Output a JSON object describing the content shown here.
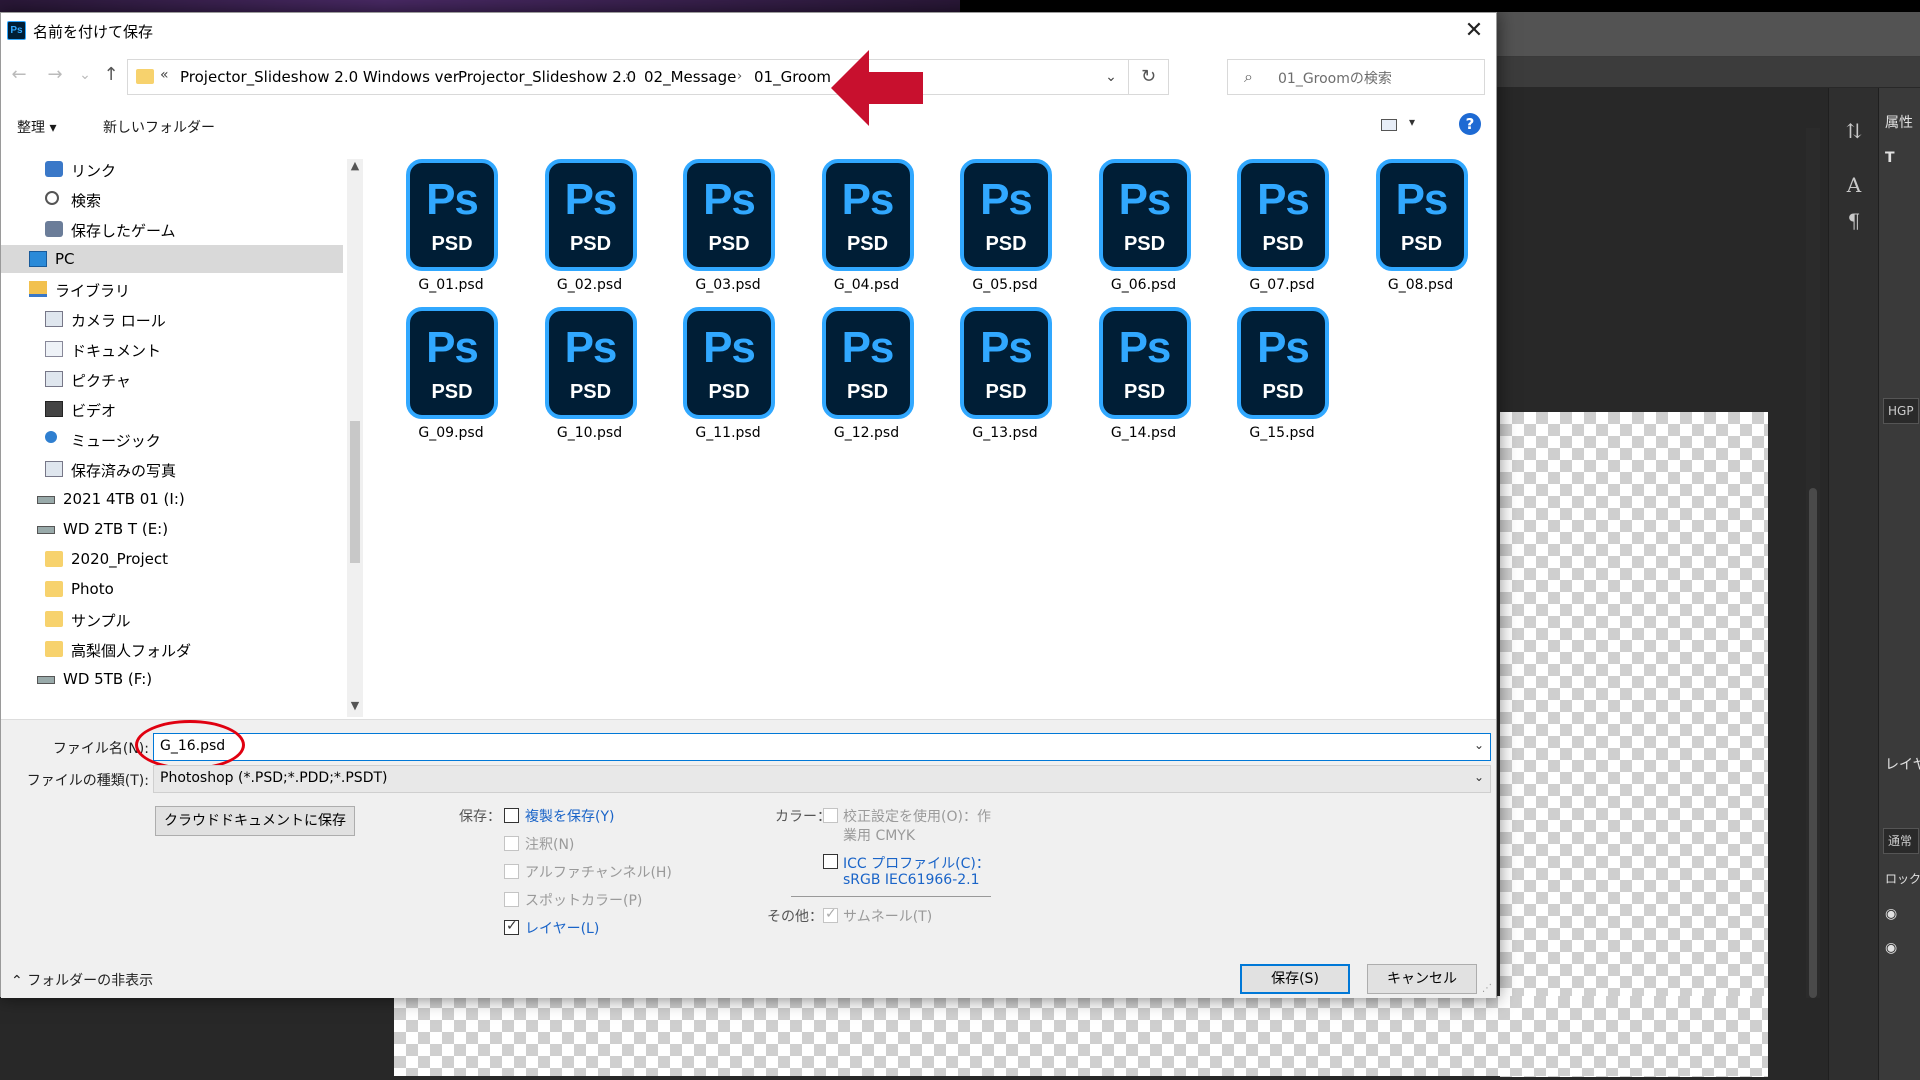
{
  "dialog": {
    "title": "名前を付けて保存",
    "app_icon_text": "Ps",
    "close_glyph": "✕"
  },
  "nav": {
    "back": "←",
    "forward": "→",
    "recent": "⌄",
    "up": "↑"
  },
  "address": {
    "overflow": "«",
    "crumbs": [
      "Projector_Slideshow 2.0 Windows ver",
      "Projector_Slideshow 2.0",
      "02_Message",
      "01_Groom"
    ],
    "separator": "›",
    "dropdown": "⌄",
    "refresh": "↻"
  },
  "search": {
    "icon": "⌕",
    "placeholder": "01_Groomの検索"
  },
  "toolbar": {
    "organize": "整理 ▾",
    "new_folder": "新しいフォルダー",
    "help": "?"
  },
  "navpane": {
    "items": [
      {
        "label": "リンク",
        "icon": "link-icon"
      },
      {
        "label": "検索",
        "icon": "search-icon"
      },
      {
        "label": "保存したゲーム",
        "icon": "game-icon"
      },
      {
        "label": "PC",
        "icon": "pc-icon",
        "selected": true
      },
      {
        "label": "ライブラリ",
        "icon": "library-icon"
      },
      {
        "label": "カメラ ロール",
        "icon": "camera-roll-icon"
      },
      {
        "label": "ドキュメント",
        "icon": "document-icon"
      },
      {
        "label": "ピクチャ",
        "icon": "picture-icon"
      },
      {
        "label": "ビデオ",
        "icon": "video-icon"
      },
      {
        "label": "ミュージック",
        "icon": "music-icon"
      },
      {
        "label": "保存済みの写真",
        "icon": "saved-photos-icon"
      },
      {
        "label": "2021 4TB 01 (I:)",
        "icon": "drive-icon"
      },
      {
        "label": "WD 2TB T (E:)",
        "icon": "drive-icon"
      },
      {
        "label": "2020_Project",
        "icon": "folder-icon"
      },
      {
        "label": "Photo",
        "icon": "folder-icon"
      },
      {
        "label": "サンプル",
        "icon": "folder-icon"
      },
      {
        "label": "高梨個人フォルダ",
        "icon": "folder-icon"
      },
      {
        "label": "WD 5TB (F:)",
        "icon": "drive-icon"
      }
    ]
  },
  "files": {
    "icon_top": "Ps",
    "icon_bottom": "PSD",
    "items": [
      "G_01.psd",
      "G_02.psd",
      "G_03.psd",
      "G_04.psd",
      "G_05.psd",
      "G_06.psd",
      "G_07.psd",
      "G_08.psd",
      "G_09.psd",
      "G_10.psd",
      "G_11.psd",
      "G_12.psd",
      "G_13.psd",
      "G_14.psd",
      "G_15.psd"
    ]
  },
  "form": {
    "filename_label": "ファイル名(N):",
    "filename_value": "G_16.psd",
    "filetype_label": "ファイルの種類(T):",
    "filetype_value": "Photoshop (*.PSD;*.PDD;*.PSDT)",
    "cloud_button": "クラウドドキュメントに保存"
  },
  "save_options": {
    "label": "保存：",
    "items": [
      {
        "label": "複製を保存(Y)",
        "checked": false,
        "enabled": true
      },
      {
        "label": "注釈(N)",
        "checked": false,
        "enabled": false
      },
      {
        "label": "アルファチャンネル(H)",
        "checked": false,
        "enabled": false
      },
      {
        "label": "スポットカラー(P)",
        "checked": false,
        "enabled": false
      },
      {
        "label": "レイヤー(L)",
        "checked": true,
        "enabled": true
      }
    ]
  },
  "color_options": {
    "label": "カラー：",
    "proof_line1": "校正設定を使用(O)：作",
    "proof_line2": "業用 CMYK",
    "icc_line1": "ICC プロファイル(C)：",
    "icc_line2": "sRGB IEC61966-2.1"
  },
  "other_options": {
    "label": "その他：",
    "thumbnail": "サムネール(T)"
  },
  "footer": {
    "hide_folders": "フォルダーの非表示",
    "save_button": "保存(S)",
    "cancel_button": "キャンセル"
  },
  "photoshop": {
    "panel_attr": "属性",
    "panel_layers": "レイヤ",
    "panel_lock": "ロック",
    "panel_normal": "通常",
    "font_field": "HGP",
    "char_a": "A",
    "pilcrow": "¶"
  },
  "colors": {
    "ps_blue": "#31a8ff",
    "ps_navy": "#001e36",
    "annotation_red": "#c8102e",
    "link_blue": "#1a64c8"
  }
}
